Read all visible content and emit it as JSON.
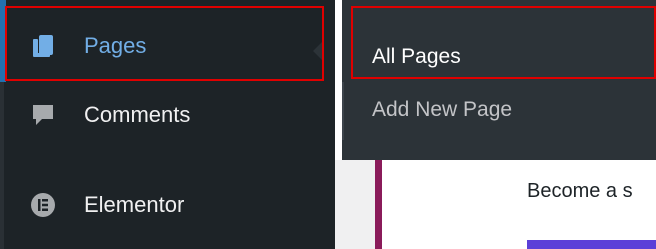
{
  "sidebar": {
    "items": [
      {
        "id": "pages",
        "label": "Pages",
        "icon": "pages-icon",
        "active": true
      },
      {
        "id": "comments",
        "label": "Comments",
        "icon": "comment-icon"
      },
      {
        "id": "elementor",
        "label": "Elementor",
        "icon": "elementor-icon"
      }
    ]
  },
  "submenu": {
    "items": [
      {
        "id": "all-pages",
        "label": "All Pages"
      },
      {
        "id": "add-new-page",
        "label": "Add New Page"
      }
    ]
  },
  "content": {
    "notice_text": "Become a s"
  },
  "colors": {
    "sidebar_bg": "#1d2327",
    "submenu_bg": "#2c3338",
    "active_text": "#72aee6",
    "active_bar": "#2271b1",
    "highlight": "#e00000",
    "accent": "#8a1b5a"
  }
}
